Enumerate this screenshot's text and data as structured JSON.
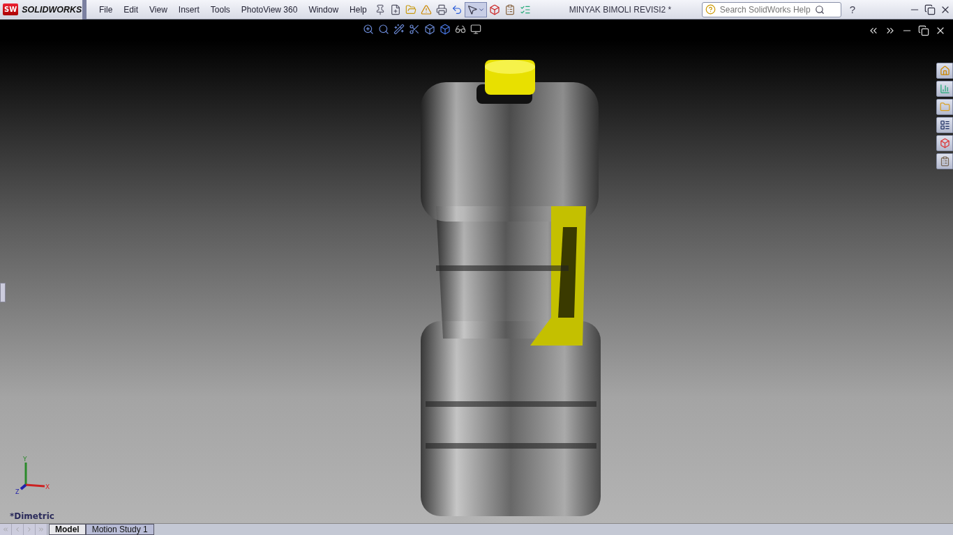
{
  "app": {
    "badge": "SW",
    "name": "SOLIDWORKS"
  },
  "menu": [
    "File",
    "Edit",
    "View",
    "Insert",
    "Tools",
    "PhotoView 360",
    "Window",
    "Help"
  ],
  "toolbar": {
    "select_pressed": true
  },
  "document_title": "MINYAK BIMOLI REVISI2 *",
  "search": {
    "placeholder": "Search SolidWorks Help"
  },
  "help": "?",
  "triad": {
    "y": "Y",
    "x": "X",
    "z": "Z"
  },
  "view_name": "*Dimetric",
  "tabs": [
    {
      "label": "Model",
      "selected": true
    },
    {
      "label": "Motion Study 1",
      "selected": false
    }
  ]
}
